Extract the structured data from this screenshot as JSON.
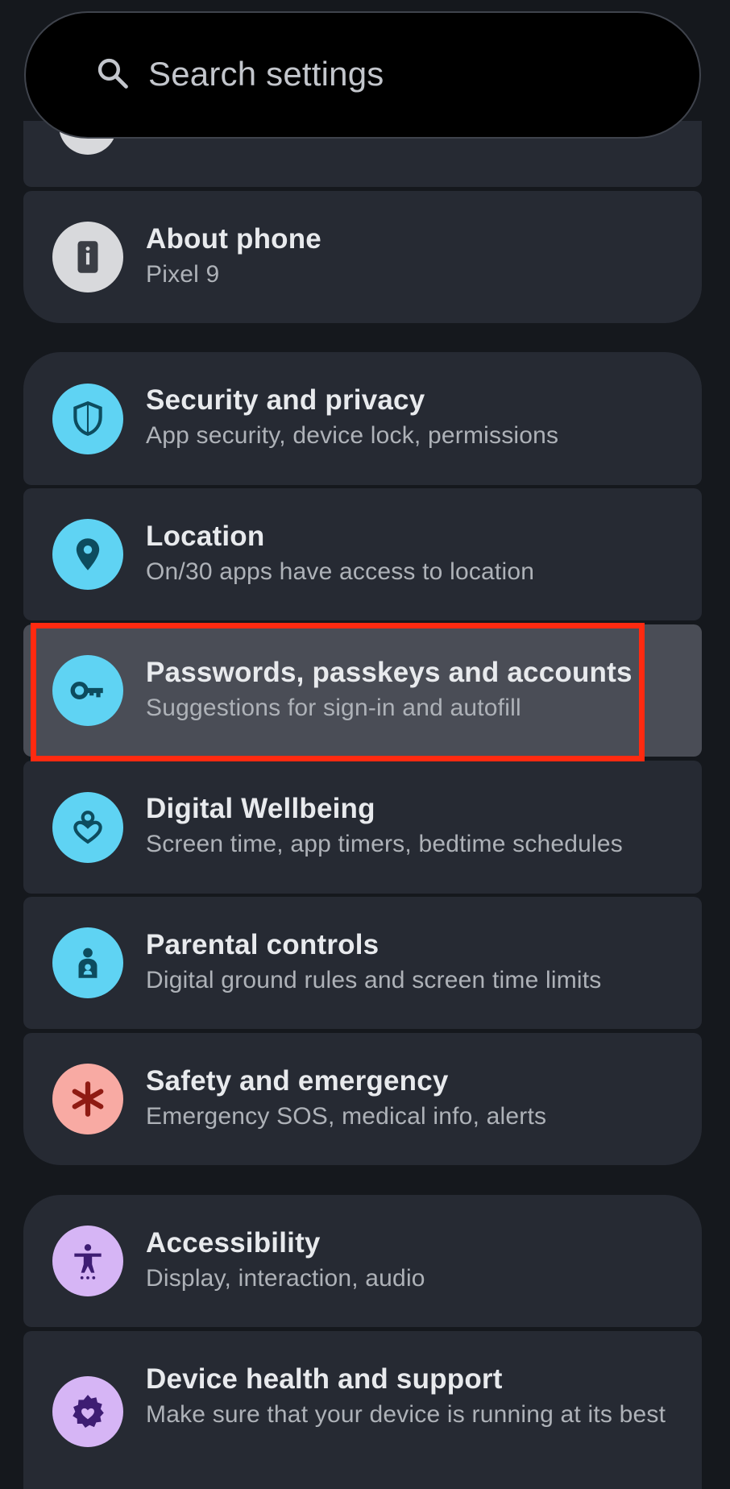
{
  "search": {
    "placeholder": "Search settings",
    "icon": "search-icon"
  },
  "items": [
    {
      "title": "About phone",
      "subtitle": "Pixel 9",
      "icon": "info-icon",
      "icon_bg": "#d8d9dc"
    },
    {
      "title": "Security and privacy",
      "subtitle": "App security, device lock, permissions",
      "icon": "shield-icon",
      "icon_bg": "#5fd3f3"
    },
    {
      "title": "Location",
      "subtitle": "On/30 apps have access to location",
      "icon": "location-pin-icon",
      "icon_bg": "#5fd3f3"
    },
    {
      "title": "Passwords, passkeys and accounts",
      "subtitle": "Suggestions for sign-in and autofill",
      "icon": "key-icon",
      "icon_bg": "#5fd3f3",
      "highlighted": true
    },
    {
      "title": "Digital Wellbeing",
      "subtitle": "Screen time, app timers, bedtime schedules",
      "icon": "wellbeing-icon",
      "icon_bg": "#5fd3f3"
    },
    {
      "title": "Parental controls",
      "subtitle": "Digital ground rules and screen time limits",
      "icon": "parental-controls-icon",
      "icon_bg": "#5fd3f3"
    },
    {
      "title": "Safety and emergency",
      "subtitle": "Emergency SOS, medical info, alerts",
      "icon": "asterisk-icon",
      "icon_bg": "#f8aaa3"
    },
    {
      "title": "Accessibility",
      "subtitle": "Display, interaction, audio",
      "icon": "accessibility-icon",
      "icon_bg": "#d6b5f5"
    },
    {
      "title": "Device health and support",
      "subtitle": "Make sure that your device is running at its best",
      "icon": "device-health-icon",
      "icon_bg": "#d6b5f5"
    }
  ],
  "colors": {
    "background": "#15181d",
    "card": "#262a33",
    "card_highlighted": "#4a4d56",
    "highlight_border": "#ff2a10",
    "title_text": "#e8eaed",
    "subtitle_text": "#aeb2b8"
  }
}
